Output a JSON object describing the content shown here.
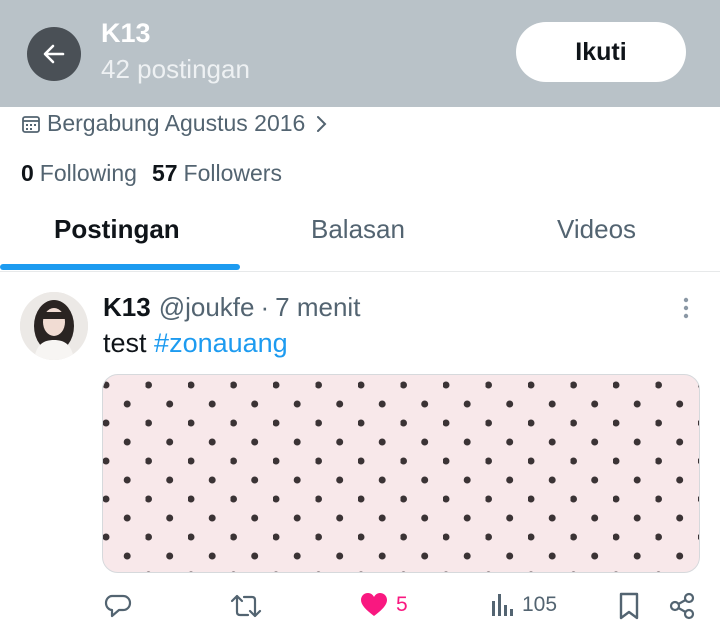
{
  "header": {
    "name": "K13",
    "post_count": "42 postingan",
    "follow_label": "Ikuti"
  },
  "profile": {
    "joined": "Bergabung Agustus 2016",
    "following_count": "0",
    "following_label": "Following",
    "followers_count": "57",
    "followers_label": "Followers"
  },
  "tabs": [
    {
      "label": "Postingan",
      "active": true
    },
    {
      "label": "Balasan",
      "active": false
    },
    {
      "label": "Videos",
      "active": false
    }
  ],
  "tweet": {
    "name": "K13",
    "handle": "@joukfe",
    "sep": "·",
    "time": "7 menit",
    "text": "test",
    "hashtag": "#zonauang",
    "likes": "5",
    "views": "105"
  },
  "colors": {
    "header_bg": "#b9c2c8",
    "accent": "#1d9bf0",
    "like": "#f91880",
    "media_bg": "#f8e8ea",
    "dot": "#3b3335"
  },
  "icons": [
    "back-arrow-icon",
    "calendar-icon",
    "chevron-right-icon",
    "more-vertical-icon",
    "reply-icon",
    "retweet-icon",
    "heart-icon",
    "views-icon",
    "bookmark-icon",
    "share-icon"
  ]
}
